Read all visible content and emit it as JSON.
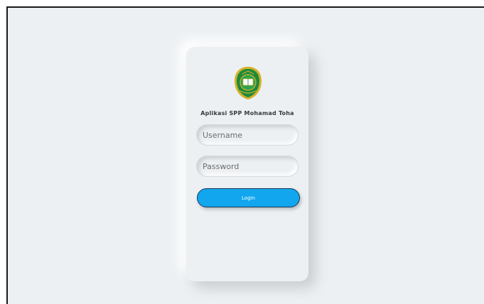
{
  "app": {
    "title": "Aplikasi SPP Mohamad Toha"
  },
  "login_form": {
    "username_placeholder": "Username",
    "username_value": "",
    "password_placeholder": "Password",
    "password_value": "",
    "login_label": "Login"
  },
  "colors": {
    "background": "#ecf0f3",
    "button": "#12a6ef",
    "button_border": "#1b3a55",
    "logo_green": "#1e8a3a",
    "logo_gold": "#d4b22b"
  },
  "icons": {
    "logo": "school-emblem-icon"
  }
}
